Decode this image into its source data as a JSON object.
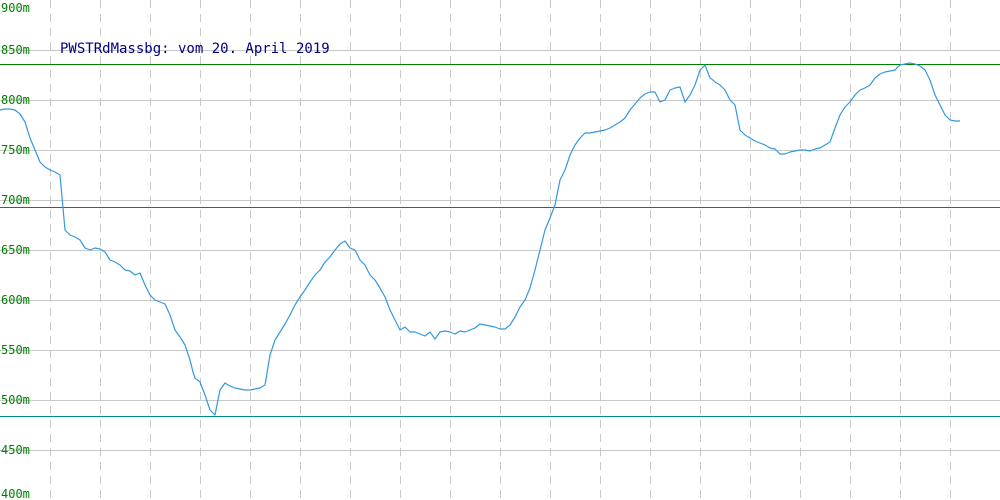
{
  "chart_data": {
    "type": "line",
    "title": "PWSTRdMassbg: vom 20. April 2019",
    "xlabel": "",
    "ylabel": "",
    "y_tick_labels": [
      "400m",
      "450m",
      "500m",
      "550m",
      "600m",
      "650m",
      "700m",
      "750m",
      "800m",
      "850m",
      "900m"
    ],
    "ylim": [
      400,
      900
    ],
    "grid": true,
    "x": [
      0,
      5,
      10,
      15,
      20,
      25,
      30,
      35,
      40,
      45,
      50,
      55,
      60,
      65,
      70,
      75,
      80,
      85,
      90,
      95,
      100,
      105,
      110,
      115,
      120,
      125,
      130,
      135,
      140,
      145,
      150,
      155,
      160,
      165,
      170,
      175,
      180,
      185,
      190,
      193,
      195,
      200,
      205,
      210,
      215,
      220,
      225,
      230,
      235,
      240,
      245,
      250,
      255,
      260,
      265,
      270,
      275,
      280,
      285,
      290,
      295,
      300,
      305,
      310,
      315,
      320,
      325,
      330,
      335,
      340,
      345,
      350,
      355,
      360,
      365,
      370,
      375,
      380,
      385,
      390,
      395,
      400,
      405,
      410,
      415,
      420,
      425,
      430,
      435,
      440,
      445,
      450,
      455,
      460,
      465,
      470,
      475,
      480,
      485,
      490,
      495,
      500,
      505,
      510,
      515,
      520,
      525,
      530,
      535,
      540,
      545,
      550,
      555,
      560,
      565,
      570,
      575,
      580,
      585,
      590,
      595,
      600,
      605,
      610,
      615,
      620,
      625,
      630,
      635,
      640,
      645,
      650,
      655,
      660,
      665,
      670,
      675,
      680,
      685,
      690,
      695,
      700,
      705,
      710,
      713,
      715,
      720,
      725,
      730,
      735,
      740,
      745,
      750,
      755,
      760,
      765,
      770,
      775,
      780,
      785,
      790,
      795,
      800,
      805,
      810,
      815,
      820,
      825,
      830,
      835,
      840,
      845,
      850,
      855,
      860,
      865,
      870,
      875,
      880,
      885,
      890,
      895,
      900,
      905,
      910,
      915,
      920,
      925,
      930,
      935,
      940,
      945,
      950,
      955,
      960,
      965,
      970,
      975,
      980,
      985,
      990,
      995,
      1000
    ],
    "series": [
      {
        "color": "#3399dd",
        "values": [
          790,
          791,
          791,
          790,
          786,
          778,
          762,
          750,
          738,
          733,
          730,
          728,
          725,
          670,
          665,
          663,
          660,
          652,
          650,
          652,
          651,
          648,
          640,
          638,
          635,
          630,
          629,
          625,
          627,
          615,
          605,
          600,
          598,
          596,
          585,
          570,
          563,
          555,
          540,
          528,
          522,
          518,
          505,
          490,
          485,
          510,
          517,
          514,
          512,
          511,
          510,
          510,
          511,
          512,
          515,
          545,
          560,
          568,
          576,
          585,
          595,
          603,
          610,
          618,
          625,
          630,
          638,
          643,
          650,
          656,
          659,
          652,
          650,
          640,
          635,
          625,
          620,
          612,
          603,
          590,
          580,
          570,
          573,
          568,
          568,
          566,
          564,
          568,
          561,
          568,
          569,
          568,
          566,
          569,
          568,
          570,
          572,
          576,
          575,
          574,
          573,
          571,
          571,
          575,
          583,
          593,
          600,
          612,
          630,
          650,
          670,
          682,
          695,
          720,
          730,
          745,
          755,
          762,
          767,
          767,
          768,
          769,
          770,
          772,
          775,
          778,
          782,
          790,
          796,
          802,
          806,
          808,
          808,
          798,
          800,
          810,
          812,
          813,
          798,
          805,
          815,
          830,
          835,
          822,
          820,
          818,
          815,
          810,
          800,
          795,
          770,
          765,
          762,
          759,
          757,
          755,
          752,
          751,
          746,
          746,
          748,
          749,
          750,
          750,
          749,
          751,
          752,
          755,
          758,
          772,
          785,
          793,
          798,
          805,
          810,
          812,
          815,
          822,
          826,
          828,
          829,
          830,
          835,
          836,
          837,
          836,
          834,
          830,
          820,
          805,
          795,
          785,
          780,
          779,
          779
        ]
      }
    ],
    "reference_lines": [
      {
        "y": 836,
        "color": "#008000"
      },
      {
        "y": 693,
        "color": "#008060"
      },
      {
        "y": 484,
        "color": "#008b8b"
      }
    ]
  }
}
